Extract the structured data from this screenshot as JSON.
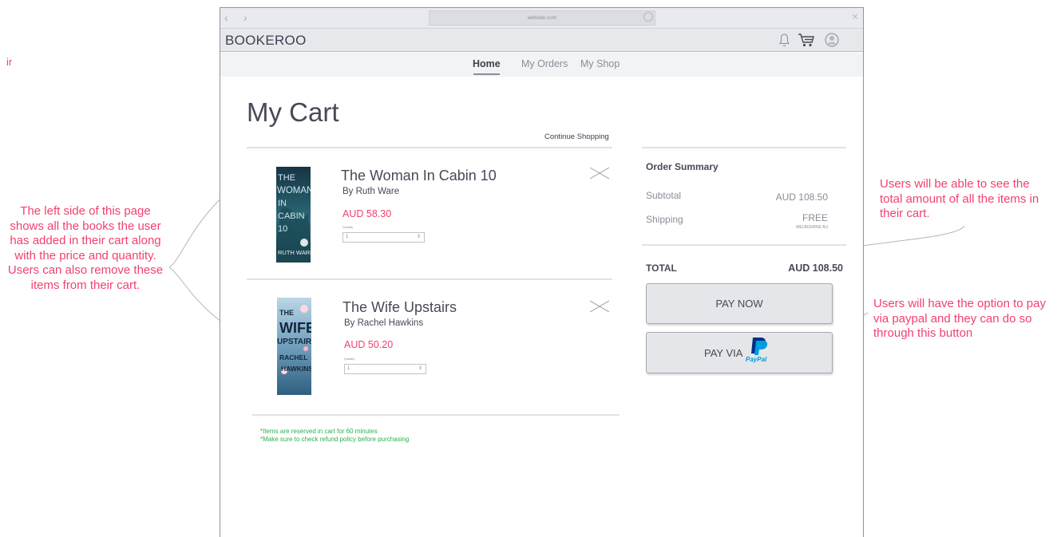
{
  "stray_mark": "ir",
  "annotations": {
    "left": "The left side of this page shows all the books the user has added in their cart along with the price and quantity. Users can also remove these items from their cart.",
    "right_top": "Users will be able to see the total amount of all the items in their cart.",
    "right_bottom": "Users will have the option to pay via paypal and they can do so through this button"
  },
  "browser": {
    "back": "‹",
    "forward": "›",
    "url": "website.com",
    "close": "×"
  },
  "header": {
    "brand": "BOOKEROO"
  },
  "tabs": [
    {
      "label": "Home",
      "active": true
    },
    {
      "label": "My Orders",
      "active": false
    },
    {
      "label": "My Shop",
      "active": false
    }
  ],
  "cart": {
    "title": "My Cart",
    "continue_label": "Continue Shopping",
    "quantity_label": "Quantity",
    "items": [
      {
        "title": "The Woman In Cabin 10",
        "author": "By Ruth Ware",
        "price": "AUD 58.30",
        "quantity": "1",
        "cover_lines": [
          "THE",
          "WOMAN",
          "IN",
          "CABIN",
          "10"
        ],
        "cover_author": "RUTH WARE"
      },
      {
        "title": "The Wife Upstairs",
        "author": "By Rachel Hawkins",
        "price": "AUD 50.20",
        "quantity": "1",
        "cover_lines": [
          "THE",
          "WIFE",
          "UPSTAIRS"
        ],
        "cover_author": "RACHEL HAWKINS"
      }
    ],
    "notes": [
      "*Items are reserved in cart for 60 minutes",
      "*Make sure to check refund policy before purchasing"
    ]
  },
  "summary": {
    "title": "Order Summary",
    "subtotal_label": "Subtotal",
    "subtotal_value": "AUD 108.50",
    "shipping_label": "Shipping",
    "shipping_value": "FREE",
    "shipping_location": "MELBOURNE AU",
    "total_label": "TOTAL",
    "total_value": "AUD 108.50",
    "pay_now_label": "PAY NOW",
    "pay_via_label": "PAY VIA",
    "paypal_word": "PayPal"
  },
  "colors": {
    "annotation": "#f0426e",
    "price": "#f0426e",
    "notes": "#2bb24c",
    "paypal_dark": "#003087",
    "paypal_light": "#009cde"
  },
  "icons": [
    "bell-icon",
    "cart-icon",
    "user-icon",
    "close-icon",
    "reload-icon",
    "paypal-icon"
  ]
}
